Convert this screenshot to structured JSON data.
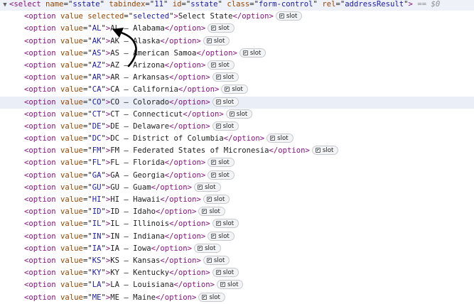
{
  "select_element": {
    "toggle_glyph": "▼",
    "open_tag": "<select",
    "attributes": [
      {
        "name": "name",
        "value": "sstate"
      },
      {
        "name": "tabindex",
        "value": "11"
      },
      {
        "name": "id",
        "value": "sstate"
      },
      {
        "name": "class",
        "value": "form-control"
      },
      {
        "name": "rel",
        "value": "addressResult"
      }
    ],
    "close_bracket": ">",
    "console_ref": "== $0"
  },
  "slot_label": "slot",
  "options": [
    {
      "value": null,
      "selected": "selected",
      "text": "Select State"
    },
    {
      "value": "AL",
      "text": "AL – Alabama"
    },
    {
      "value": "AK",
      "text": "AK – Alaska"
    },
    {
      "value": "AS",
      "text": "AS – American Samoa"
    },
    {
      "value": "AZ",
      "text": "AZ – Arizona"
    },
    {
      "value": "AR",
      "text": "AR – Arkansas"
    },
    {
      "value": "CA",
      "text": "CA – California"
    },
    {
      "value": "CO",
      "text": "CO – Colorado",
      "highlighted": true
    },
    {
      "value": "CT",
      "text": "CT – Connecticut"
    },
    {
      "value": "DE",
      "text": "DE – Delaware"
    },
    {
      "value": "DC",
      "text": "DC – District of Columbia"
    },
    {
      "value": "FM",
      "text": "FM – Federated States of Micronesia"
    },
    {
      "value": "FL",
      "text": "FL – Florida"
    },
    {
      "value": "GA",
      "text": "GA – Georgia"
    },
    {
      "value": "GU",
      "text": "GU – Guam"
    },
    {
      "value": "HI",
      "text": "HI – Hawaii"
    },
    {
      "value": "ID",
      "text": "ID – Idaho"
    },
    {
      "value": "IL",
      "text": "IL – Illinois"
    },
    {
      "value": "IN",
      "text": "IN – Indiana"
    },
    {
      "value": "IA",
      "text": "IA – Iowa"
    },
    {
      "value": "KS",
      "text": "KS – Kansas"
    },
    {
      "value": "KY",
      "text": "KY – Kentucky"
    },
    {
      "value": "LA",
      "text": "LA – Louisiana"
    },
    {
      "value": "ME",
      "text": "ME – Maine"
    }
  ],
  "colors": {
    "tag": "#881280",
    "attribute_name": "#994500",
    "attribute_value": "#1a1aa6",
    "highlight_row": "#e9eef7"
  }
}
